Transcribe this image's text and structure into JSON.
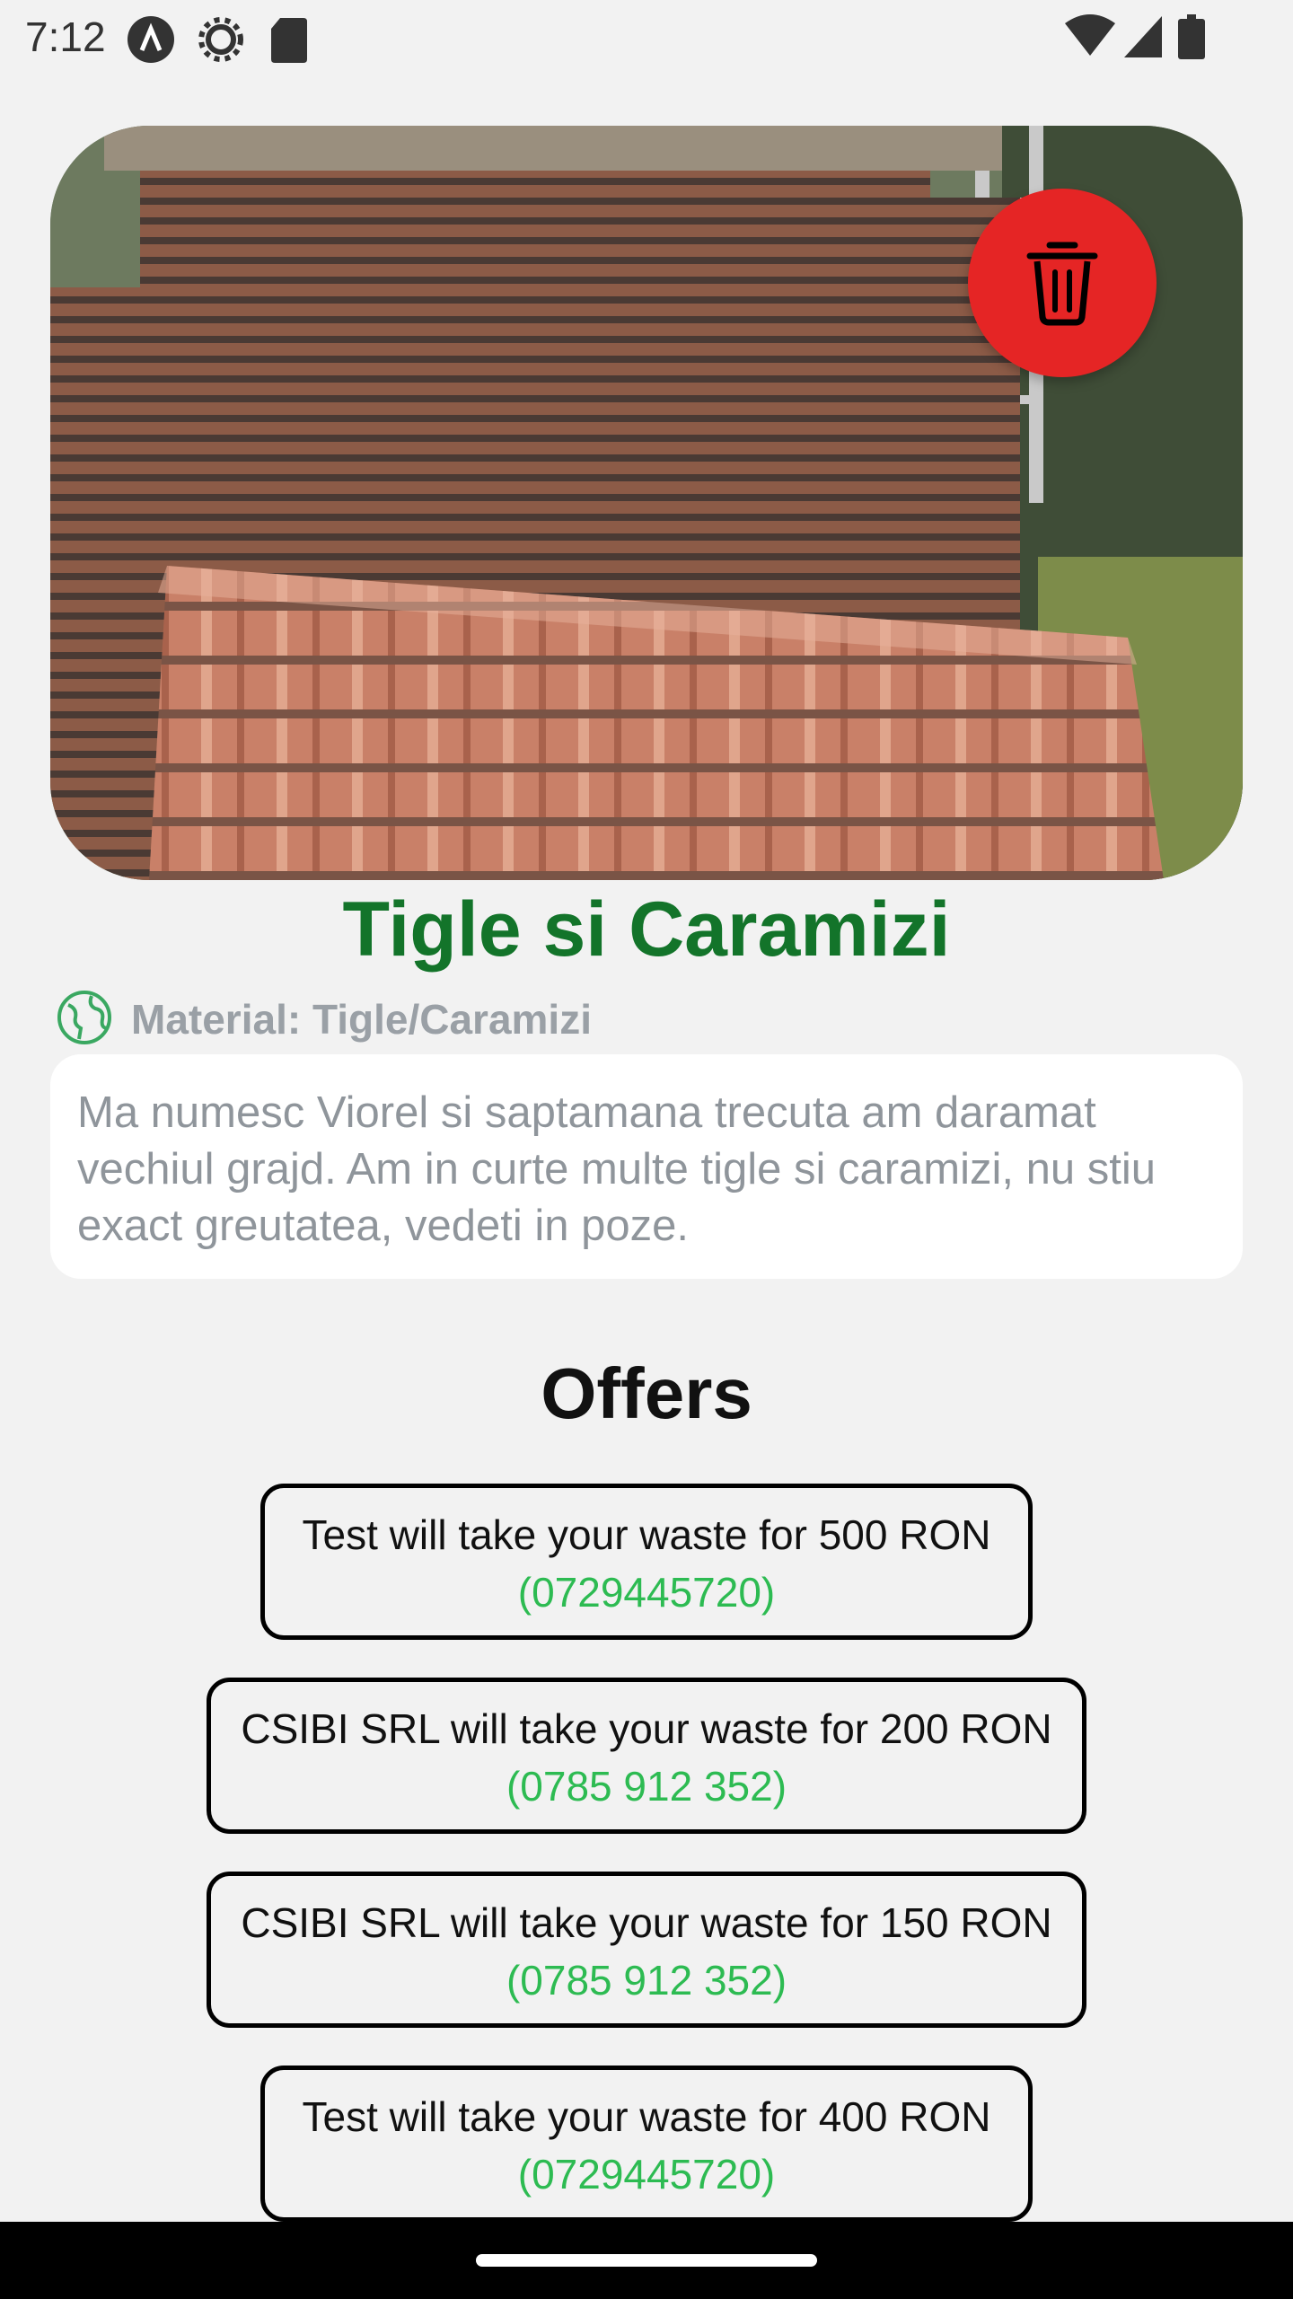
{
  "status_bar": {
    "time": "7:12",
    "icons": [
      "app-notification-icon",
      "settings-icon",
      "sd-card-icon",
      "wifi-icon",
      "signal-icon",
      "battery-icon"
    ]
  },
  "listing": {
    "image_subject": "stacks of old clay roof tiles",
    "title": "Tigle si Caramizi",
    "material_label": "Material: Tigle/Caramizi",
    "description": " Ma numesc Viorel si saptamana trecuta am daramat vechiul grajd. Am in curte multe tigle si caramizi, nu stiu exact greutatea, vedeti in poze."
  },
  "offers": {
    "title": "Offers",
    "items": [
      {
        "text": "Test will take your waste for 500 RON",
        "phone": "(0729445720)"
      },
      {
        "text": "CSIBI SRL will take your waste for 200 RON",
        "phone": "(0785 912 352)"
      },
      {
        "text": "CSIBI SRL will take your waste for 150 RON",
        "phone": "(0785 912 352)"
      },
      {
        "text": "Test will take your waste for 400 RON",
        "phone": "(0729445720)"
      }
    ]
  },
  "colors": {
    "accent_green": "#13742a",
    "phone_green": "#2dbb52",
    "delete_red": "#e52525",
    "muted_gray": "#9aa0a6"
  }
}
